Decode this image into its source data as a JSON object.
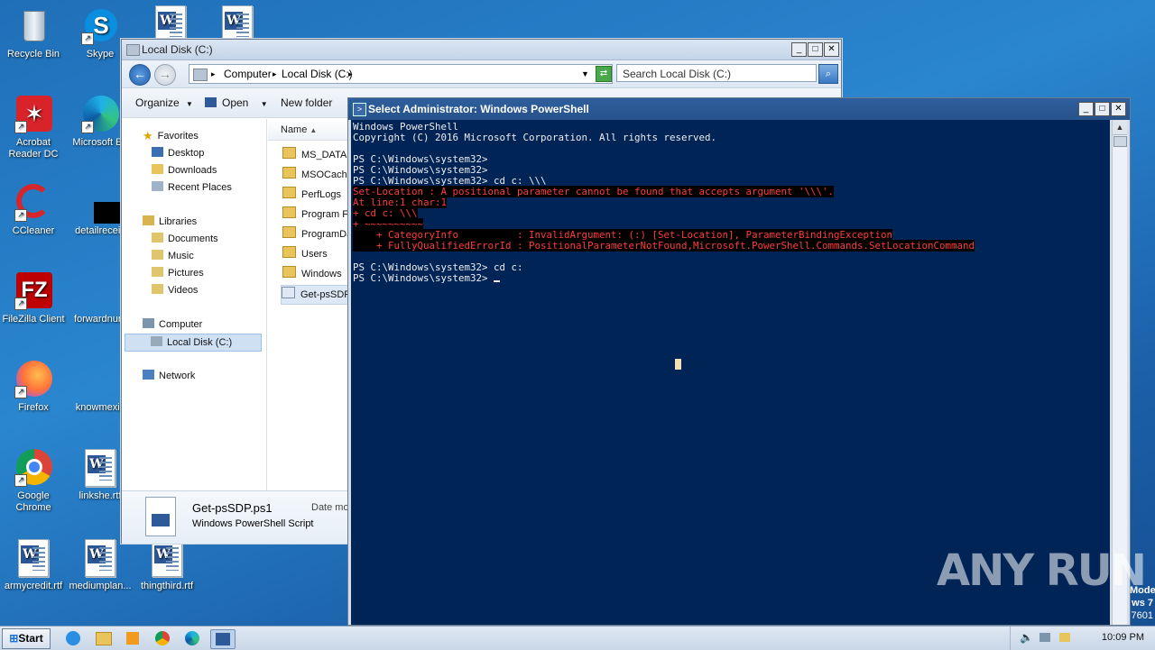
{
  "desktop": {
    "icons": [
      {
        "label": "Recycle Bin"
      },
      {
        "label": "Skype"
      },
      {
        "label": "Acrobat Reader DC"
      },
      {
        "label": "Microsoft Ed"
      },
      {
        "label": "CCleaner"
      },
      {
        "label": "detailreceiv"
      },
      {
        "label": "FileZilla Client"
      },
      {
        "label": "forwardnum"
      },
      {
        "label": "Firefox"
      },
      {
        "label": "knowmexic"
      },
      {
        "label": "Google Chrome"
      },
      {
        "label": "linkshe.rtf"
      },
      {
        "label": "armycredit.rtf"
      },
      {
        "label": "mediumplan..."
      },
      {
        "label": "thingthird.rtf"
      }
    ],
    "watermark": "ANY RUN",
    "corner_text": [
      "Mode",
      "ws 7",
      "7601"
    ]
  },
  "explorer": {
    "title": "Local Disk (C:)",
    "breadcrumb": [
      "Computer",
      "Local Disk (C:)"
    ],
    "search_placeholder": "Search Local Disk (C:)",
    "toolbar": {
      "organize": "Organize",
      "open": "Open",
      "new_folder": "New folder"
    },
    "nav": {
      "favorites": "Favorites",
      "favorites_items": [
        "Desktop",
        "Downloads",
        "Recent Places"
      ],
      "libraries": "Libraries",
      "libraries_items": [
        "Documents",
        "Music",
        "Pictures",
        "Videos"
      ],
      "computer": "Computer",
      "computer_items": [
        "Local Disk (C:)"
      ],
      "network": "Network"
    },
    "column_name": "Name",
    "files": [
      "MS_DATA",
      "MSOCache",
      "PerfLogs",
      "Program Fi",
      "ProgramDa",
      "Users",
      "Windows",
      "Get-psSDP"
    ],
    "details": {
      "filename": "Get-psSDP.ps1",
      "filetype": "Windows PowerShell Script",
      "date_label": "Date mo"
    }
  },
  "powershell": {
    "title": "Select Administrator: Windows PowerShell",
    "lines": [
      {
        "text": "Windows PowerShell",
        "type": "normal"
      },
      {
        "text": "Copyright (C) 2016 Microsoft Corporation. All rights reserved.",
        "type": "normal"
      },
      {
        "text": "",
        "type": "normal"
      },
      {
        "text": "PS C:\\Windows\\system32>",
        "type": "normal"
      },
      {
        "text": "PS C:\\Windows\\system32>",
        "type": "normal"
      },
      {
        "text": "PS C:\\Windows\\system32> cd c: \\\\\\",
        "type": "normal"
      },
      {
        "text": "Set-Location : A positional parameter cannot be found that accepts argument '\\\\\\'.",
        "type": "error"
      },
      {
        "text": "At line:1 char:1",
        "type": "error"
      },
      {
        "text": "+ cd c: \\\\\\",
        "type": "error"
      },
      {
        "text": "+ ~~~~~~~~~~",
        "type": "error"
      },
      {
        "text": "    + CategoryInfo          : InvalidArgument: (:) [Set-Location], ParameterBindingException",
        "type": "error"
      },
      {
        "text": "    + FullyQualifiedErrorId : PositionalParameterNotFound,Microsoft.PowerShell.Commands.SetLocationCommand",
        "type": "error"
      },
      {
        "text": "",
        "type": "normal"
      },
      {
        "text": "PS C:\\Windows\\system32> cd c:",
        "type": "normal"
      },
      {
        "text": "PS C:\\Windows\\system32> ",
        "type": "prompt"
      }
    ]
  },
  "taskbar": {
    "start_label": "Start",
    "clock": "10:09 PM"
  }
}
